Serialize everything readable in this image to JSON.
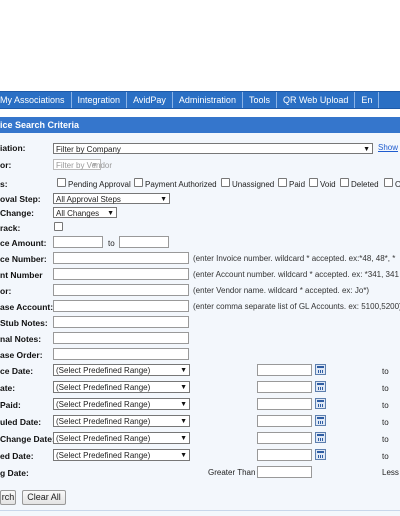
{
  "nav": {
    "items": [
      "My Associations",
      "Integration",
      "AvidPay",
      "Administration",
      "Tools",
      "QR Web Upload",
      "En"
    ]
  },
  "section": {
    "title": "ice Search Criteria"
  },
  "form": {
    "association_label": "iation:",
    "association_value": "Filter by Company",
    "show_link": "Show",
    "vendor_label": "or:",
    "vendor_placeholder": "Filter by Vendor",
    "status_label": "s:",
    "status_options": [
      "Pending Approval",
      "Payment Authorized",
      "Unassigned",
      "Paid",
      "Void",
      "Deleted",
      "O"
    ],
    "approval_step_label": "oval Step:",
    "approval_step_value": "All Approval Steps",
    "change_label": "Change:",
    "change_value": "All Changes",
    "track_label": "rack:",
    "amount_label": "ce Amount:",
    "amount_to": "to",
    "invoice_number_label": "ce Number:",
    "invoice_number_hint": "(enter Invoice number. wildcard * accepted. ex:*48, 48*, *",
    "account_number_label": "nt Number",
    "account_number_hint": "(enter Account number. wildcard * accepted. ex: *341, 341",
    "vendor_name_label": "or:",
    "vendor_name_hint": "(enter Vendor name. wildcard * accepted. ex: Jo*)",
    "gl_account_label": "ase Account:",
    "gl_account_hint": "(enter comma separate list of GL Accounts. ex: 5100,5200)",
    "stub_notes_label": "Stub Notes:",
    "internal_notes_label": "nal Notes:",
    "purchase_order_label": "ase Order:"
  },
  "date_rows": [
    {
      "label": "ce Date:",
      "value": "(Select Predefined Range)",
      "to": "to"
    },
    {
      "label": "ate:",
      "value": "(Select Predefined Range)",
      "to": "to"
    },
    {
      "label": "Paid:",
      "value": "(Select Predefined Range)",
      "to": "to"
    },
    {
      "label": "uled Date:",
      "value": "(Select Predefined Range)",
      "to": "to"
    },
    {
      "label": "Change Date:",
      "value": "(Select Predefined Range)",
      "to": "to"
    },
    {
      "label": "ed Date:",
      "value": "(Select Predefined Range)",
      "to": "to"
    }
  ],
  "aging": {
    "label": "g Date:",
    "greater_than": "Greater Than",
    "less": "Less"
  },
  "buttons": {
    "search": "rch",
    "clear": "Clear All"
  }
}
